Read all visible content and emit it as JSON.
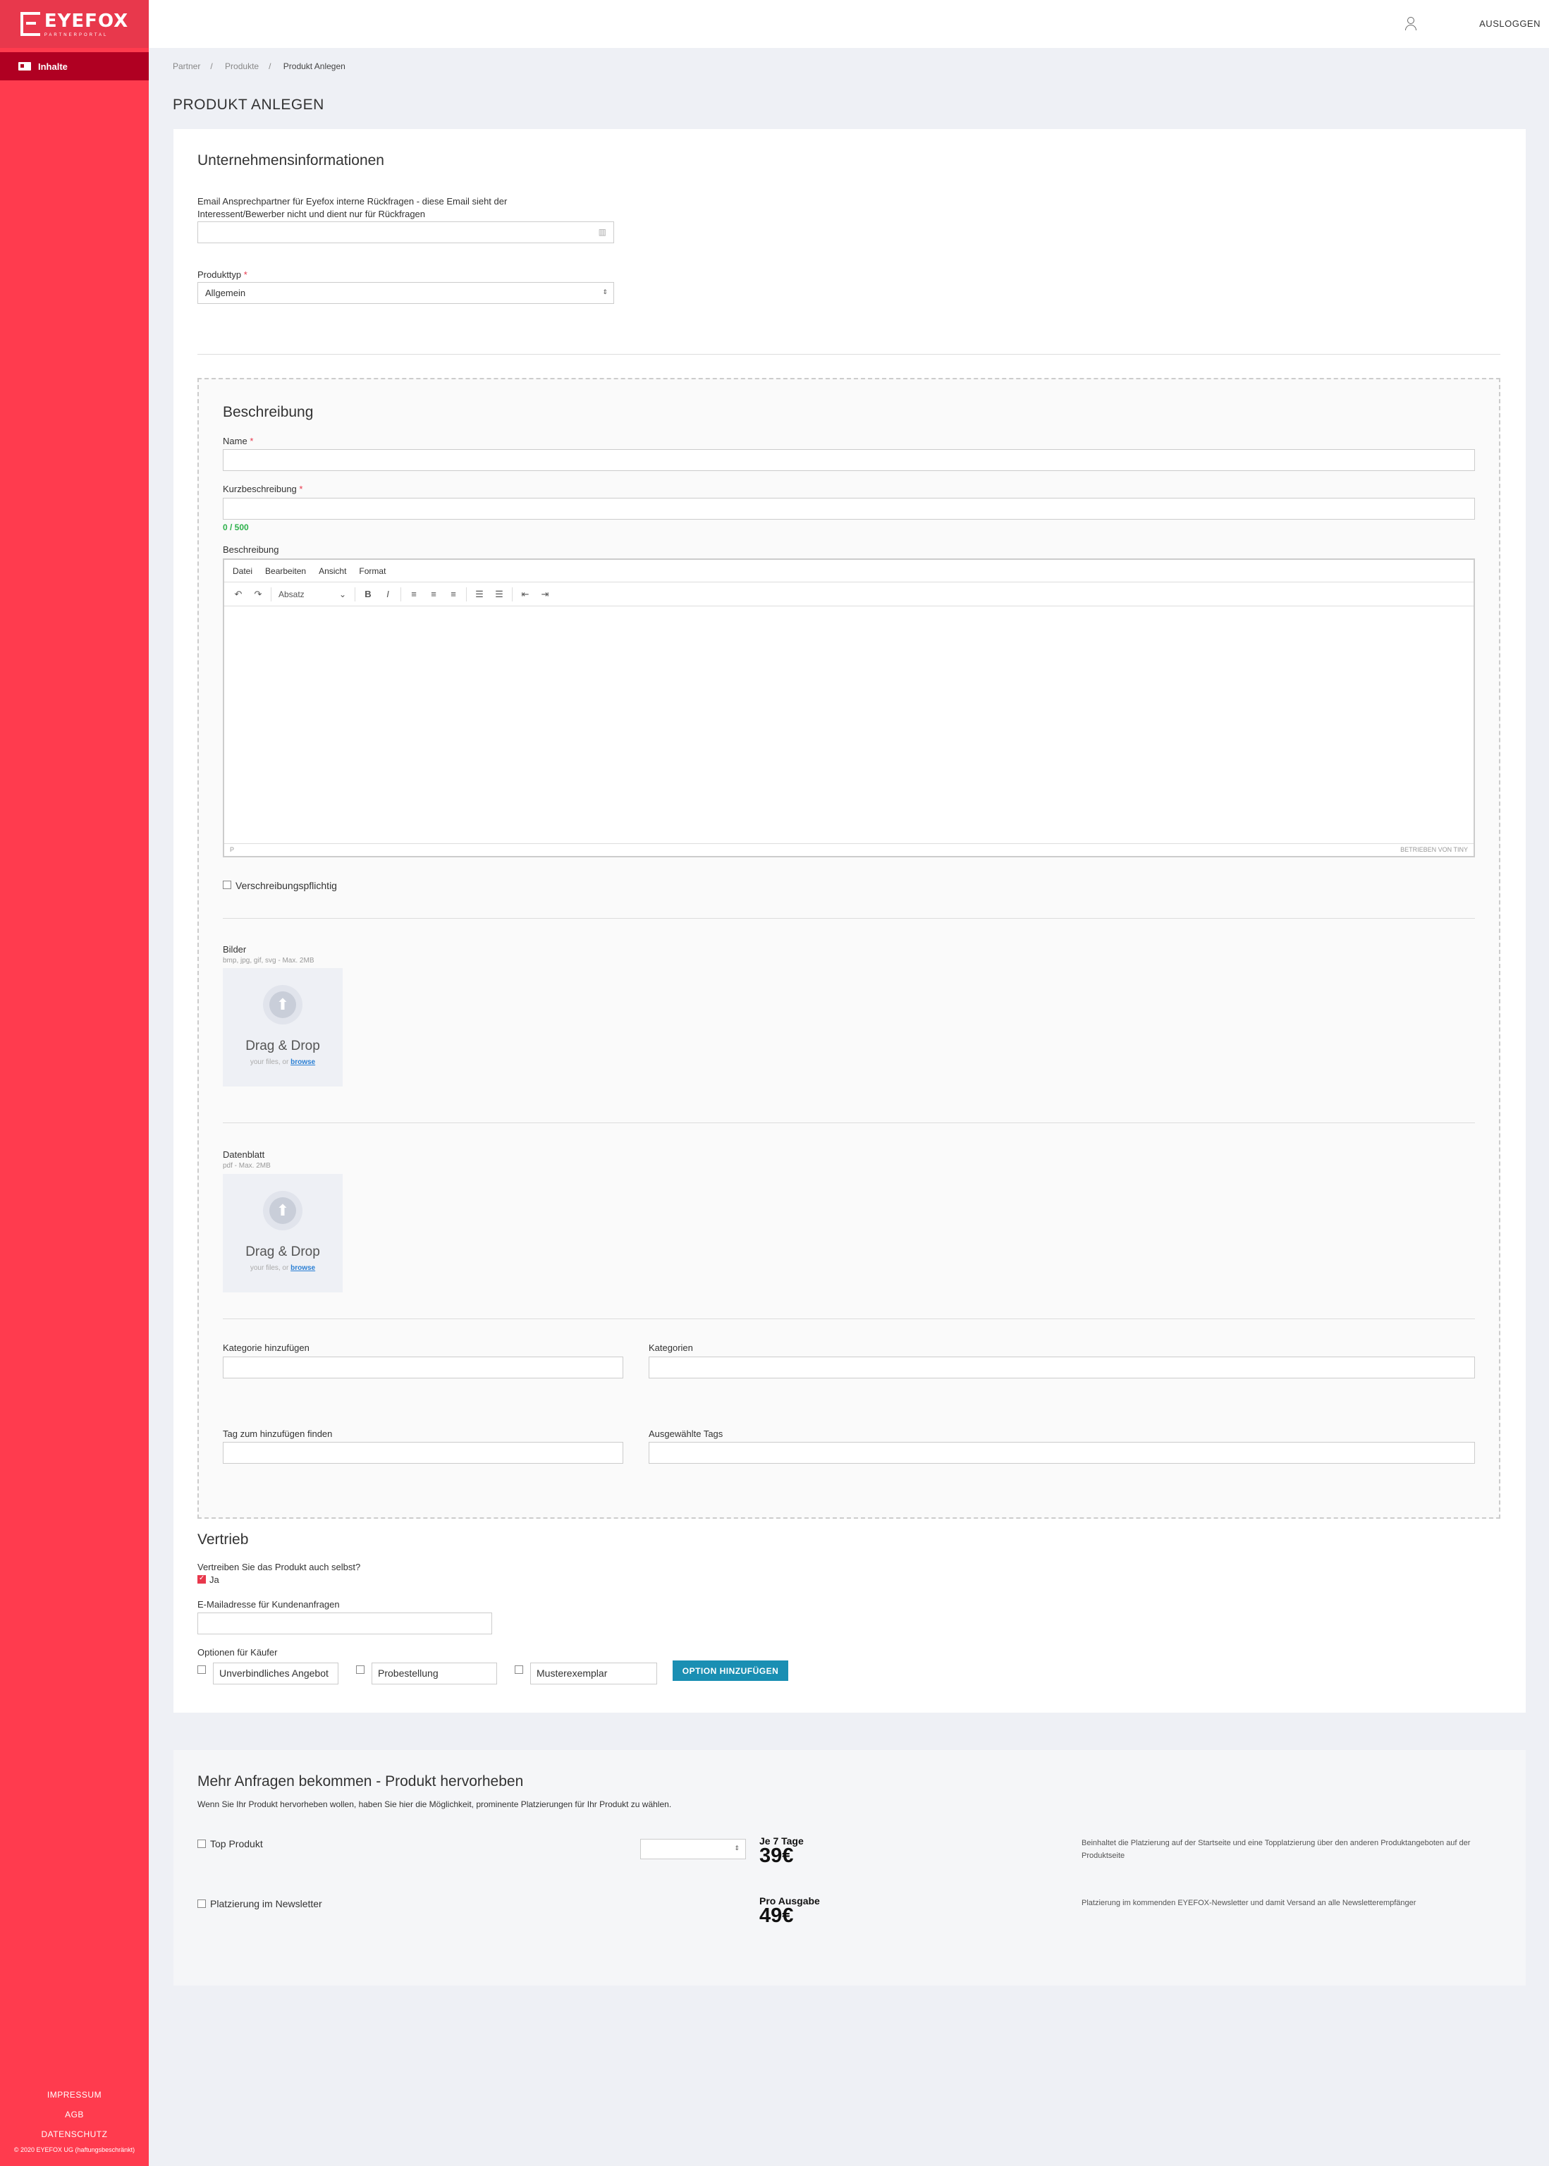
{
  "brand": {
    "name": "EYEFOX",
    "tagline": "PARTNERPORTAL"
  },
  "sidebar": {
    "nav_item": "Inhalte",
    "footer_links": [
      "IMPRESSUM",
      "AGB",
      "DATENSCHUTZ"
    ],
    "copyright": "© 2020 EYEFOX UG (haftungsbeschränkt)"
  },
  "topbar": {
    "logout": "AUSLOGGEN"
  },
  "breadcrumb": [
    "Partner",
    "Produkte",
    "Produkt Anlegen"
  ],
  "page_title": "PRODUKT ANLEGEN",
  "company": {
    "title": "Unternehmensinformationen",
    "email_label": "Email Ansprechpartner für Eyefox interne Rückfragen - diese Email sieht der Interessent/Bewerber nicht und dient nur für Rückfragen",
    "type_label": "Produkttyp",
    "type_value": "Allgemein"
  },
  "description": {
    "title": "Beschreibung",
    "name_label": "Name",
    "short_label": "Kurzbeschreibung",
    "counter": "0 / 500",
    "desc_label": "Beschreibung",
    "editor_menu": [
      "Datei",
      "Bearbeiten",
      "Ansicht",
      "Format"
    ],
    "editor_block": "Absatz",
    "editor_status_left": "P",
    "editor_status_right": "BETRIEBEN VON TINY",
    "prescription": "Verschreibungspflichtig"
  },
  "images": {
    "label": "Bilder",
    "hint": "bmp, jpg, gif, svg - Max. 2MB",
    "drop": "Drag & Drop",
    "sub": "your files, or",
    "browse": "browse"
  },
  "datasheet": {
    "label": "Datenblatt",
    "hint": "pdf - Max. 2MB",
    "drop": "Drag & Drop",
    "sub": "your files, or",
    "browse": "browse"
  },
  "categories": {
    "add_label": "Kategorie hinzufügen",
    "list_label": "Kategorien"
  },
  "tags": {
    "find_label": "Tag zum hinzufügen finden",
    "selected_label": "Ausgewählte Tags"
  },
  "sales": {
    "title": "Vertrieb",
    "question": "Vertreiben Sie das Produkt auch selbst?",
    "yes": "Ja",
    "email_label": "E-Mailadresse für Kundenanfragen",
    "options_label": "Optionen für Käufer",
    "options": [
      "Unverbindliches Angebot",
      "Probestellung",
      "Musterexemplar"
    ],
    "add_option": "OPTION HINZUFÜGEN"
  },
  "promo": {
    "title": "Mehr Anfragen bekommen - Produkt hervorheben",
    "subtitle": "Wenn Sie Ihr Produkt hervorheben wollen, haben Sie hier die Möglichkeit, prominente Platzierungen für Ihr Produkt zu wählen.",
    "top": {
      "label": "Top Produkt",
      "price_title": "Je 7 Tage",
      "price": "39€",
      "desc": "Beinhaltet die Platzierung auf der Startseite und eine Topplatzierung über den anderen Produktangeboten auf der Produktseite"
    },
    "newsletter": {
      "label": "Platzierung im Newsletter",
      "price_title": "Pro Ausgabe",
      "price": "49€",
      "desc": "Platzierung im kommenden EYEFOX-Newsletter und damit Versand an alle Newsletterempfänger"
    }
  }
}
